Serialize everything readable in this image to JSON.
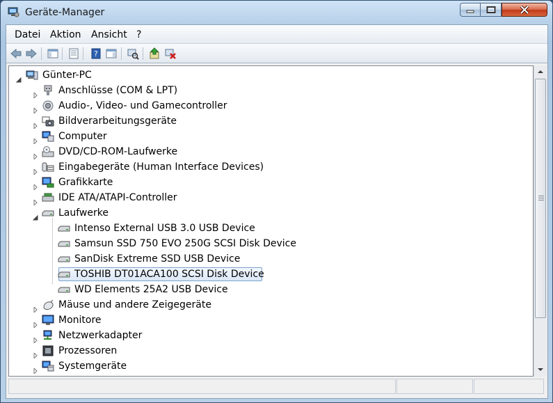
{
  "window": {
    "title": "Geräte-Manager"
  },
  "menu": {
    "items": [
      "Datei",
      "Aktion",
      "Ansicht",
      "?"
    ]
  },
  "toolbar": {
    "buttons": [
      "back-icon",
      "forward-icon",
      "show-hide-console-tree-icon",
      "properties-icon",
      "help-icon",
      "action-pane-icon",
      "scan-hardware-icon",
      "update-driver-icon",
      "uninstall-icon"
    ]
  },
  "tree": {
    "root": "Günter-PC",
    "categories": [
      {
        "label": "Anschlüsse (COM & LPT)",
        "icon": "port-icon"
      },
      {
        "label": "Audio-, Video- und Gamecontroller",
        "icon": "speaker-icon"
      },
      {
        "label": "Bildverarbeitungsgeräte",
        "icon": "camera-icon"
      },
      {
        "label": "Computer",
        "icon": "computer-icon"
      },
      {
        "label": "DVD/CD-ROM-Laufwerke",
        "icon": "dvd-drive-icon"
      },
      {
        "label": "Eingabegeräte (Human Interface Devices)",
        "icon": "hid-icon"
      },
      {
        "label": "Grafikkarte",
        "icon": "display-adapter-icon"
      },
      {
        "label": "IDE ATA/ATAPI-Controller",
        "icon": "ide-controller-icon"
      },
      {
        "label": "Laufwerke",
        "icon": "disk-drive-icon"
      }
    ],
    "drives": [
      "Intenso External USB 3.0 USB Device",
      "Samsun  SSD 750 EVO 250G SCSI Disk Device",
      "SanDisk Extreme SSD USB Device",
      "TOSHIB  DT01ACA100 SCSI Disk Device",
      "WD Elements 25A2 USB Device"
    ],
    "selected_drive_index": 3,
    "more_categories": [
      {
        "label": "Mäuse und andere Zeigegeräte",
        "icon": "mouse-icon"
      },
      {
        "label": "Monitore",
        "icon": "monitor-icon"
      },
      {
        "label": "Netzwerkadapter",
        "icon": "network-adapter-icon"
      },
      {
        "label": "Prozessoren",
        "icon": "processor-icon"
      },
      {
        "label": "Systemgeräte",
        "icon": "system-devices-icon"
      }
    ]
  },
  "colors": {
    "selection_border": "#7da2ce",
    "titlebar": "#b9d2ea",
    "close_button": "#c2391b"
  }
}
